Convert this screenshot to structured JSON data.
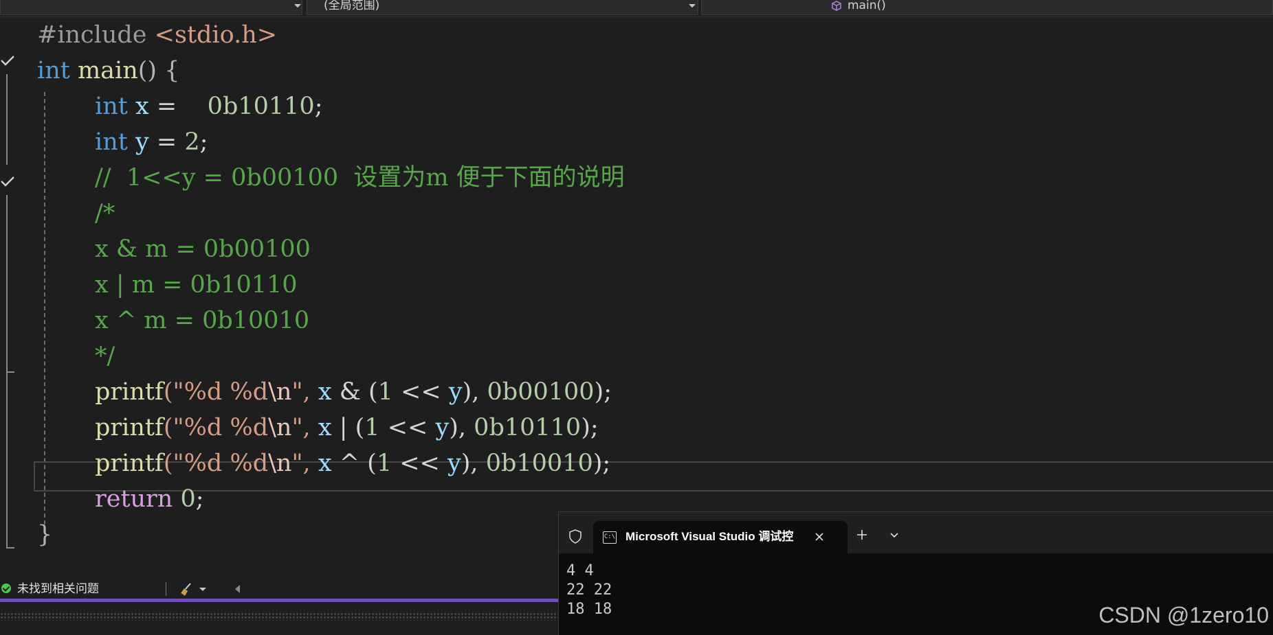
{
  "navbar": {
    "scope": "(全局范围)",
    "member": "main()"
  },
  "code": {
    "line_include_directive": "#include",
    "line_include_file": "<stdio.h>",
    "kw_int": "int",
    "fn_main": "main",
    "main_parens_brace": "() {",
    "var_x": "x",
    "var_y": "y",
    "eq": " = ",
    "x_value": "0b10110",
    "y_value": "2",
    "semicolon": ";",
    "comment_line": "//  1<<y = 0b00100  设置为m 便于下面的说明",
    "block_open": "/*",
    "block_and": "x & m = 0b00100",
    "block_or": "x | m = 0b10110",
    "block_xor": "x ^ m = 0b10010",
    "block_close": "*/",
    "fn_printf": "printf",
    "fmt_open": "(\"",
    "fmt_text": "%d %d",
    "fmt_escape": "\\n",
    "fmt_close": "\",",
    "op_and": " & ",
    "op_or": " | ",
    "op_xor": " ^ ",
    "shift_open": "(",
    "shift_one": "1",
    "shift_op": " << ",
    "shift_close": "),",
    "lit_and": "0b00100",
    "lit_or": "0b10110",
    "lit_xor": "0b10010",
    "call_close": ");",
    "kw_return": "return",
    "return_value": "0",
    "closing_brace": "}"
  },
  "status": {
    "issues_text": "未找到相关问题"
  },
  "terminal": {
    "tab_title": "Microsoft Visual Studio 调试控",
    "cmd_glyph": "C:\\",
    "output": [
      "4 4",
      "22 22",
      "18 18"
    ]
  },
  "watermark": "CSDN @1zero10",
  "colors": {
    "keyword": "#569cd6",
    "control_keyword": "#d8a0df",
    "function": "#dcdcaa",
    "variable": "#9cdcfe",
    "number": "#b5cea8",
    "string": "#d69d85",
    "comment": "#57a64a",
    "status_accent": "#6e4fb8"
  },
  "icons": {
    "fold_check": "check-icon",
    "member": "cube-icon",
    "status": "check-circle-icon",
    "cleanup": "broom-icon",
    "terminal_shield": "shield-icon",
    "terminal_tab": "cmd-icon",
    "close": "close-icon",
    "new_tab": "plus-icon",
    "dropdown": "chevron-down-icon"
  }
}
